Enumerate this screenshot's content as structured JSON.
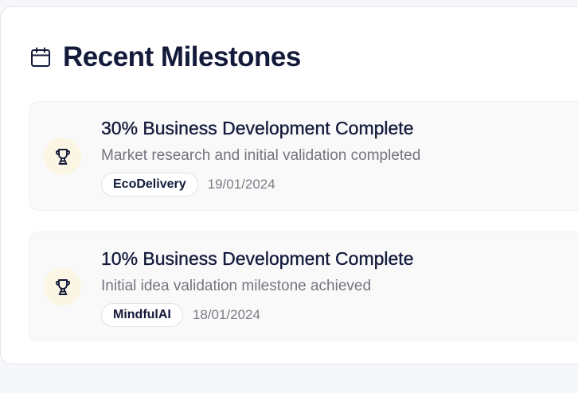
{
  "section": {
    "title": "Recent Milestones",
    "icon": "calendar-icon"
  },
  "colors": {
    "title": "#131a3a",
    "muted": "#74767f",
    "trophy_bg": "#fbf6e3",
    "card_bg": "#ffffff",
    "item_bg": "#f9f9fa"
  },
  "milestones": [
    {
      "title": "30% Business Development Complete",
      "description": "Market research and initial validation completed",
      "startup": "EcoDelivery",
      "date": "19/01/2024",
      "icon": "trophy-icon"
    },
    {
      "title": "10% Business Development Complete",
      "description": "Initial idea validation milestone achieved",
      "startup": "MindfulAI",
      "date": "18/01/2024",
      "icon": "trophy-icon"
    }
  ]
}
